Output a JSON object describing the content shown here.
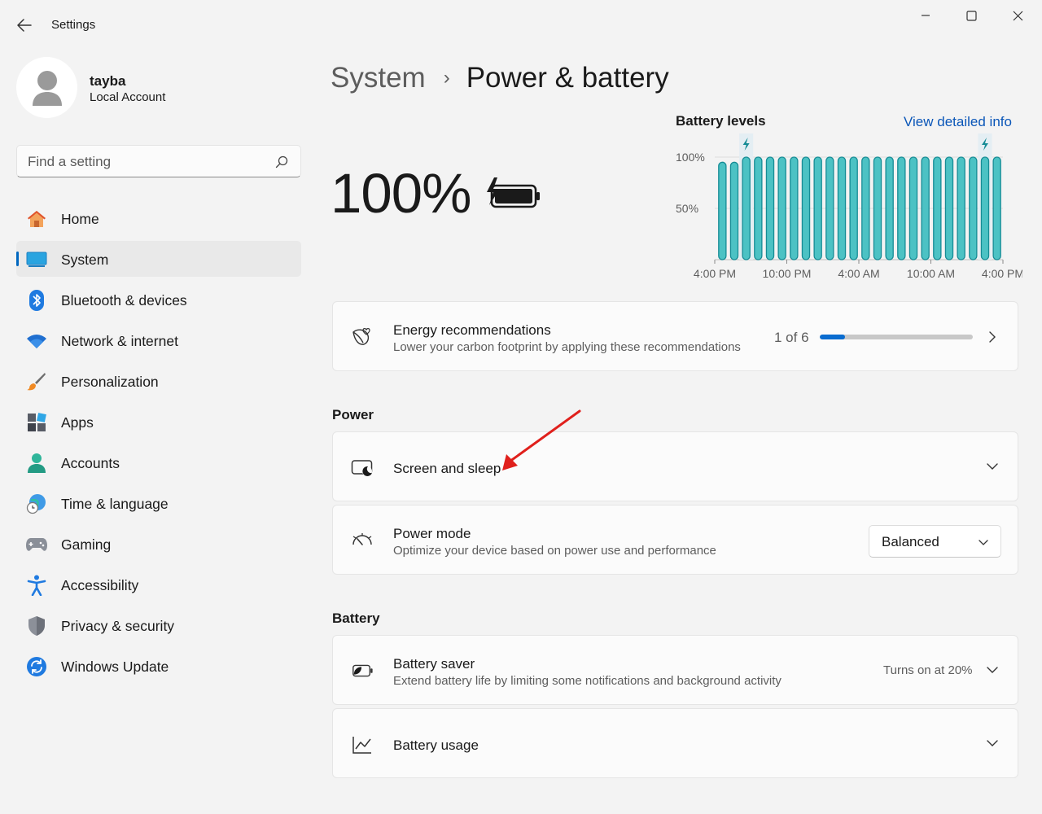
{
  "window": {
    "app_title": "Settings"
  },
  "profile": {
    "name": "tayba",
    "account_type": "Local Account"
  },
  "search": {
    "placeholder": "Find a setting"
  },
  "nav": {
    "items": [
      {
        "label": "Home",
        "icon": "home-icon"
      },
      {
        "label": "System",
        "icon": "system-icon",
        "selected": true
      },
      {
        "label": "Bluetooth & devices",
        "icon": "bluetooth-icon"
      },
      {
        "label": "Network & internet",
        "icon": "wifi-icon"
      },
      {
        "label": "Personalization",
        "icon": "brush-icon"
      },
      {
        "label": "Apps",
        "icon": "apps-icon"
      },
      {
        "label": "Accounts",
        "icon": "accounts-icon"
      },
      {
        "label": "Time & language",
        "icon": "globe-clock-icon"
      },
      {
        "label": "Gaming",
        "icon": "gamepad-icon"
      },
      {
        "label": "Accessibility",
        "icon": "accessibility-icon"
      },
      {
        "label": "Privacy & security",
        "icon": "shield-icon"
      },
      {
        "label": "Windows Update",
        "icon": "update-icon"
      }
    ]
  },
  "breadcrumb": {
    "parent": "System",
    "separator": "›",
    "current": "Power & battery"
  },
  "battery": {
    "percent_text": "100%",
    "charging": true,
    "levels_title": "Battery levels",
    "view_detailed_info": "View detailed info"
  },
  "chart_data": {
    "type": "bar",
    "title": "Battery levels",
    "ylim": [
      0,
      100
    ],
    "y_ticks": [
      "100%",
      "50%"
    ],
    "y_tick_values": [
      100,
      50
    ],
    "x_tick_labels": [
      "4:00 PM",
      "10:00 PM",
      "4:00 AM",
      "10:00 AM",
      "4:00 PM"
    ],
    "values": [
      95,
      95,
      100,
      100,
      100,
      100,
      100,
      100,
      100,
      100,
      100,
      100,
      100,
      100,
      100,
      100,
      100,
      100,
      100,
      100,
      100,
      100,
      100,
      100
    ],
    "charging_markers": [
      2,
      22
    ],
    "bar_color": "#4cc2c4",
    "bar_edge_color": "#168c95",
    "grid": true
  },
  "energy": {
    "title": "Energy recommendations",
    "subtitle": "Lower your carbon footprint by applying these recommendations",
    "progress_text": "1 of 6",
    "progress_fraction": 0.1667
  },
  "power_section": {
    "label": "Power",
    "screen_sleep": {
      "title": "Screen and sleep"
    },
    "power_mode": {
      "title": "Power mode",
      "subtitle": "Optimize your device based on power use and performance",
      "selected": "Balanced"
    }
  },
  "battery_section": {
    "label": "Battery",
    "saver": {
      "title": "Battery saver",
      "subtitle": "Extend battery life by limiting some notifications and background activity",
      "status": "Turns on at 20%"
    },
    "usage": {
      "title": "Battery usage"
    }
  },
  "colors": {
    "accent": "#0067c0",
    "link": "#0a56b8",
    "annotation_arrow": "#e0201c"
  }
}
